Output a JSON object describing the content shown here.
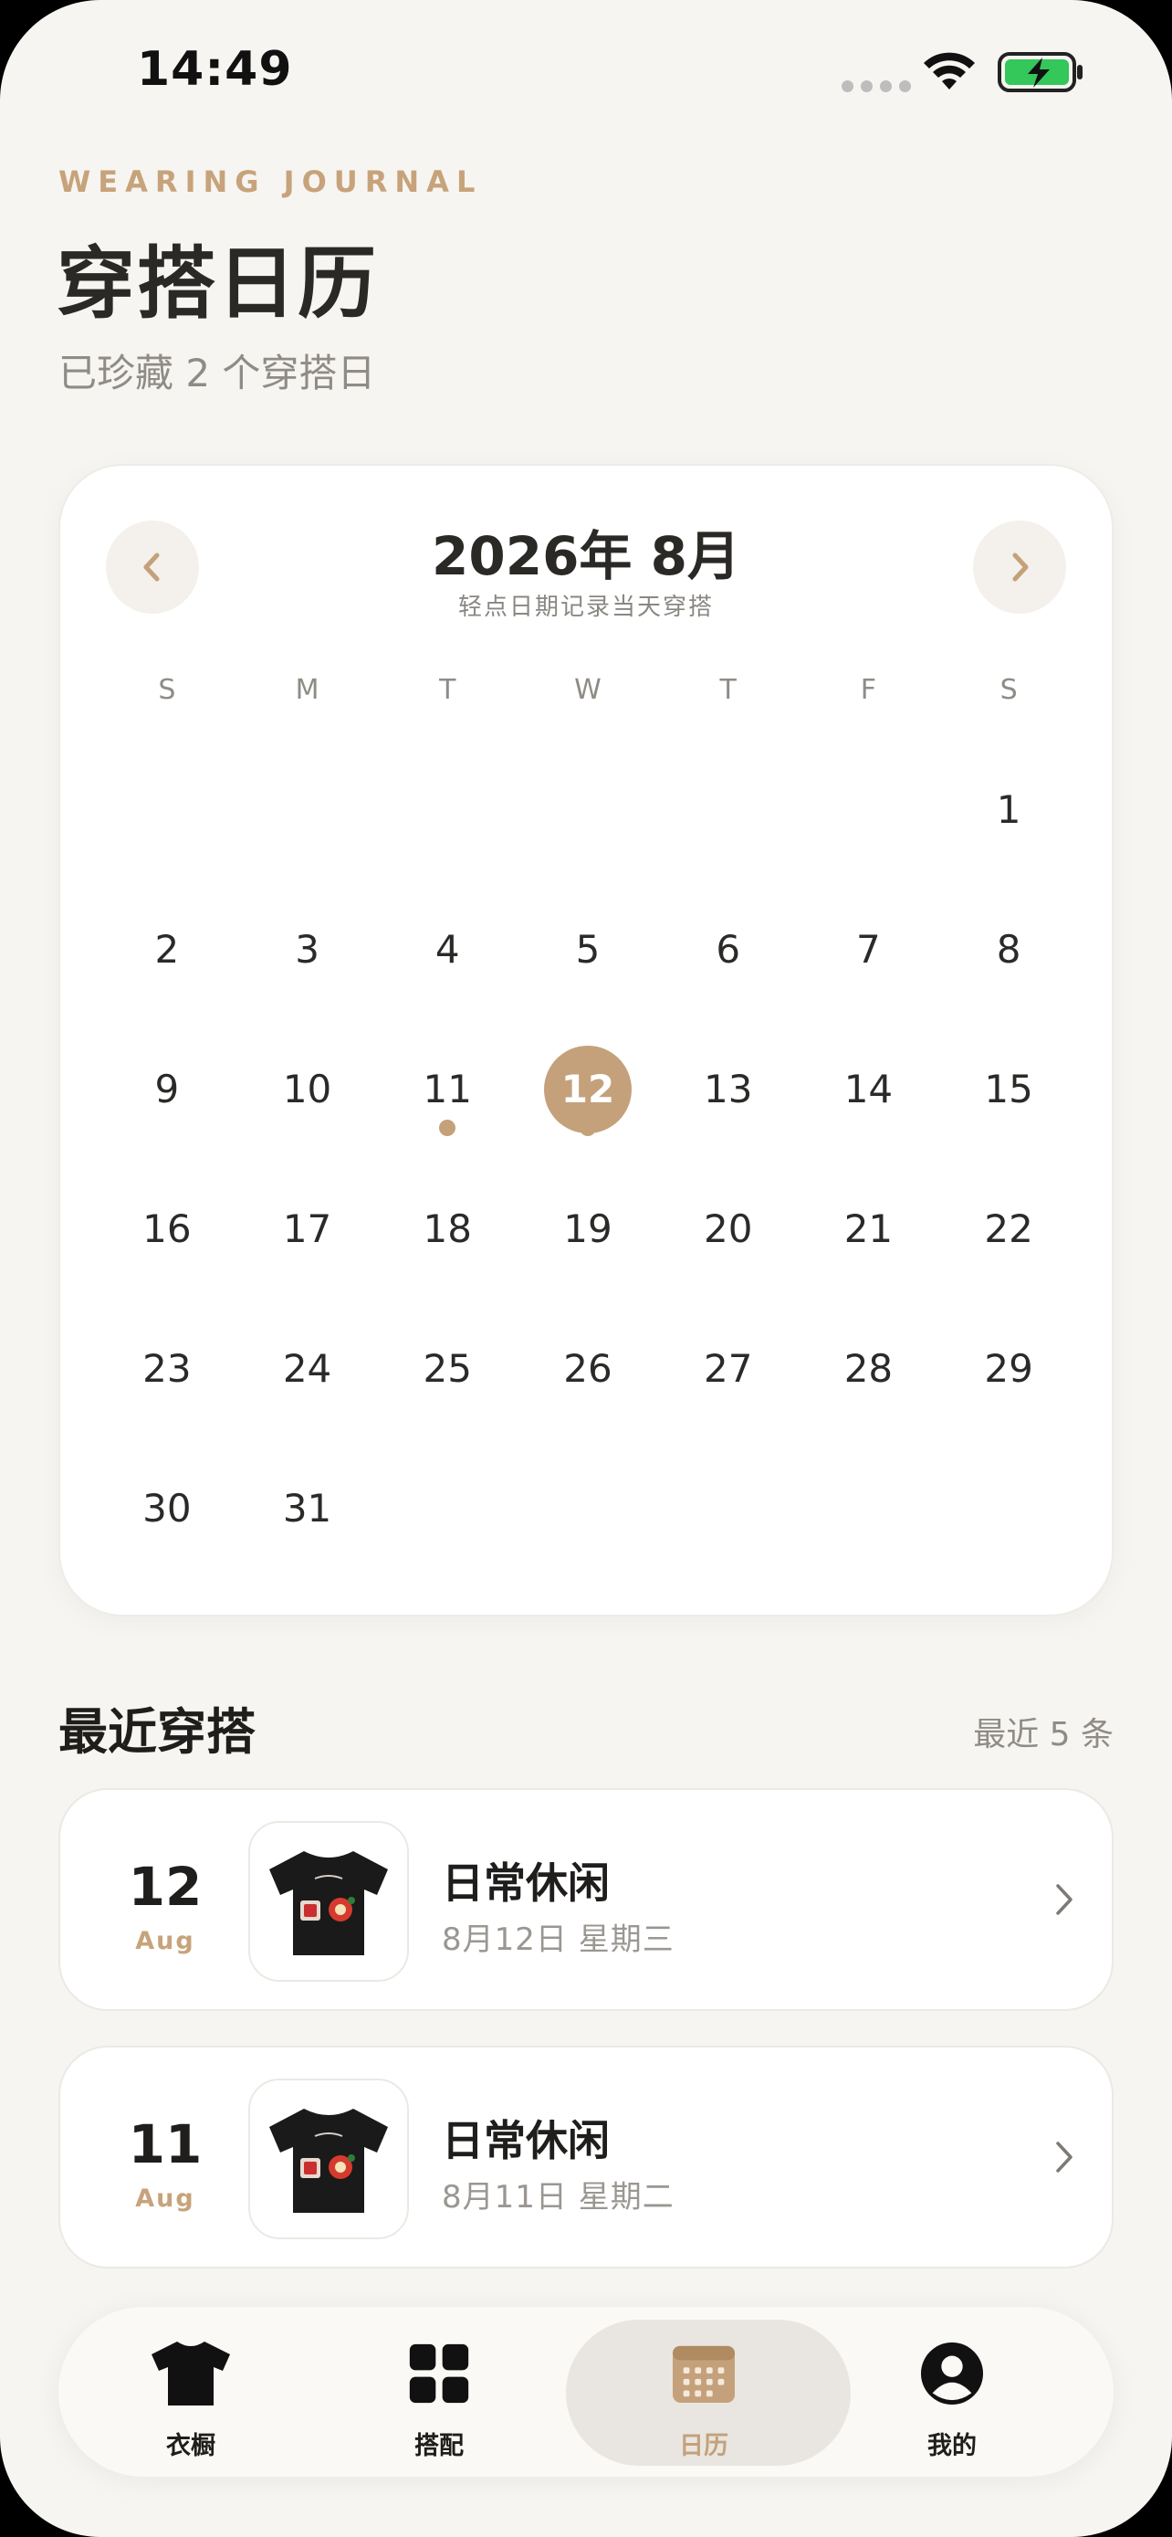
{
  "status_bar": {
    "time": "14:49",
    "icons": [
      "cellular-signal-icon",
      "wifi-icon",
      "battery-charging-icon"
    ]
  },
  "header": {
    "eyebrow": "WEARING JOURNAL",
    "title": "穿搭日历",
    "subtitle": "已珍藏 2 个穿搭日"
  },
  "calendar": {
    "month_title": "2026年 8月",
    "hint": "轻点日期记录当天穿搭",
    "prev_icon": "chevron-left-icon",
    "next_icon": "chevron-right-icon",
    "weekdays": [
      "S",
      "M",
      "T",
      "W",
      "T",
      "F",
      "S"
    ],
    "days": [
      "",
      "",
      "",
      "",
      "",
      "",
      "1",
      "2",
      "3",
      "4",
      "5",
      "6",
      "7",
      "8",
      "9",
      "10",
      "11",
      "12",
      "13",
      "14",
      "15",
      "16",
      "17",
      "18",
      "19",
      "20",
      "21",
      "22",
      "23",
      "24",
      "25",
      "26",
      "27",
      "28",
      "29",
      "30",
      "31",
      "",
      "",
      "",
      "",
      ""
    ],
    "selected_day": "12",
    "marked_days": [
      "11",
      "12"
    ],
    "accent_color": "#c4a17a"
  },
  "recent": {
    "title": "最近穿搭",
    "count": "最近 5 条",
    "entries": [
      {
        "day": "12",
        "month": "Aug",
        "name": "日常休闲",
        "date": "8月12日 星期三",
        "thumb_icon": "black-tshirt-image"
      },
      {
        "day": "11",
        "month": "Aug",
        "name": "日常休闲",
        "date": "8月11日 星期二",
        "thumb_icon": "black-tshirt-image"
      }
    ]
  },
  "tabbar": {
    "tabs": [
      {
        "label": "衣橱",
        "icon": "tshirt-icon"
      },
      {
        "label": "搭配",
        "icon": "grid-icon"
      },
      {
        "label": "日历",
        "icon": "calendar-icon",
        "active": true
      },
      {
        "label": "我的",
        "icon": "profile-icon"
      }
    ]
  }
}
